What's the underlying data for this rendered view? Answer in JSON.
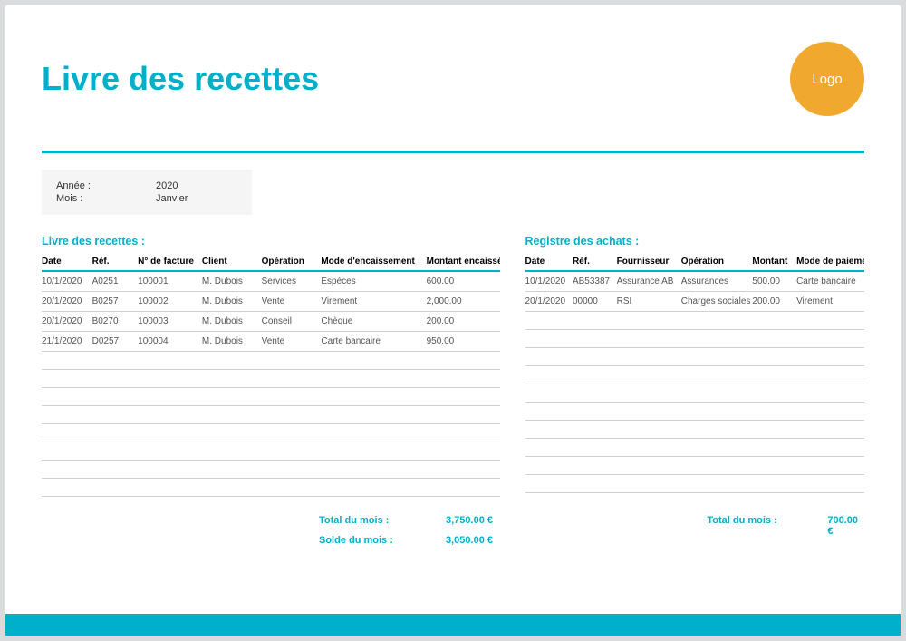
{
  "header": {
    "title": "Livre des recettes",
    "logo_text": "Logo"
  },
  "meta": {
    "year_label": "Année :",
    "year_value": "2020",
    "month_label": "Mois :",
    "month_value": "Janvier"
  },
  "recettes": {
    "title": "Livre des recettes :",
    "headers": {
      "date": "Date",
      "ref": "Réf.",
      "facture": "N° de facture",
      "client": "Client",
      "operation": "Opération",
      "mode": "Mode d'encaissement",
      "montant": "Montant encaissé"
    },
    "rows": [
      {
        "date": "10/1/2020",
        "ref": "A0251",
        "facture": "100001",
        "client": "M. Dubois",
        "operation": "Services",
        "mode": "Espèces",
        "montant": "600.00"
      },
      {
        "date": "20/1/2020",
        "ref": "B0257",
        "facture": "100002",
        "client": "M. Dubois",
        "operation": "Vente",
        "mode": "Virement",
        "montant": "2,000.00"
      },
      {
        "date": "20/1/2020",
        "ref": "B0270",
        "facture": "100003",
        "client": "M. Dubois",
        "operation": "Conseil",
        "mode": "Chèque",
        "montant": "200.00"
      },
      {
        "date": "21/1/2020",
        "ref": "D0257",
        "facture": "100004",
        "client": "M. Dubois",
        "operation": "Vente",
        "mode": "Carte bancaire",
        "montant": "950.00"
      }
    ],
    "total_label": "Total du mois :",
    "total_value": "3,750.00 €",
    "solde_label": "Solde du mois :",
    "solde_value": "3,050.00 €"
  },
  "achats": {
    "title": "Registre des achats :",
    "headers": {
      "date": "Date",
      "ref": "Réf.",
      "fournisseur": "Fournisseur",
      "operation": "Opération",
      "montant": "Montant",
      "mode": "Mode de paiement"
    },
    "rows": [
      {
        "date": "10/1/2020",
        "ref": "AB53387",
        "fournisseur": "Assurance AB",
        "operation": "Assurances",
        "montant": "500.00",
        "mode": "Carte bancaire"
      },
      {
        "date": "20/1/2020",
        "ref": "00000",
        "fournisseur": "RSI",
        "operation": "Charges sociales",
        "montant": "200.00",
        "mode": "Virement"
      }
    ],
    "total_label": "Total du mois :",
    "total_value": "700.00 €"
  },
  "chart_data": {
    "type": "table",
    "tables": [
      {
        "name": "Livre des recettes",
        "columns": [
          "Date",
          "Réf.",
          "N° de facture",
          "Client",
          "Opération",
          "Mode d'encaissement",
          "Montant encaissé"
        ],
        "rows": [
          [
            "10/1/2020",
            "A0251",
            "100001",
            "M. Dubois",
            "Services",
            "Espèces",
            600.0
          ],
          [
            "20/1/2020",
            "B0257",
            "100002",
            "M. Dubois",
            "Vente",
            "Virement",
            2000.0
          ],
          [
            "20/1/2020",
            "B0270",
            "100003",
            "M. Dubois",
            "Conseil",
            "Chèque",
            200.0
          ],
          [
            "21/1/2020",
            "D0257",
            "100004",
            "M. Dubois",
            "Vente",
            "Carte bancaire",
            950.0
          ]
        ],
        "total_mois": 3750.0,
        "solde_mois": 3050.0
      },
      {
        "name": "Registre des achats",
        "columns": [
          "Date",
          "Réf.",
          "Fournisseur",
          "Opération",
          "Montant",
          "Mode de paiement"
        ],
        "rows": [
          [
            "10/1/2020",
            "AB53387",
            "Assurance AB",
            "Assurances",
            500.0,
            "Carte bancaire"
          ],
          [
            "20/1/2020",
            "00000",
            "RSI",
            "Charges sociales",
            200.0,
            "Virement"
          ]
        ],
        "total_mois": 700.0
      }
    ]
  }
}
